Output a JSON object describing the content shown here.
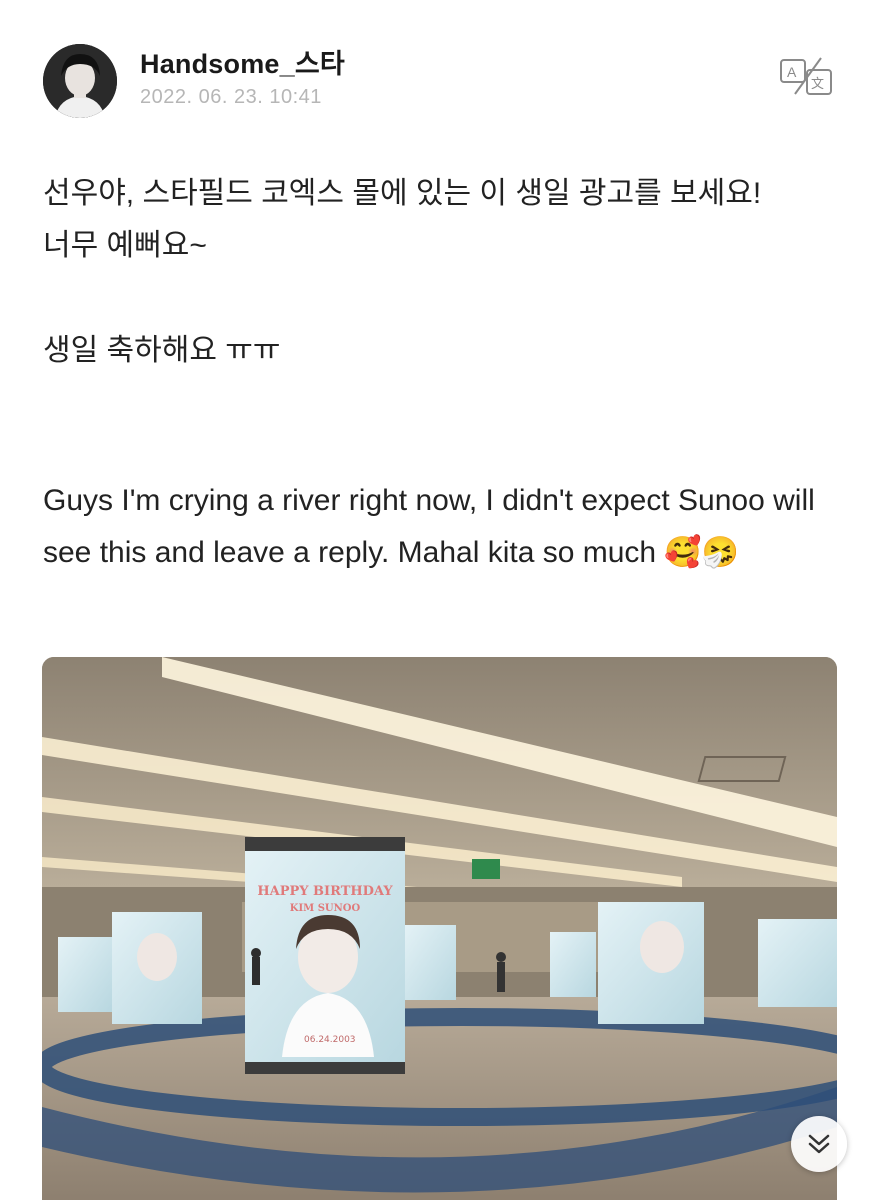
{
  "post": {
    "author": "Handsome_스타",
    "timestamp": "2022. 06. 23. 10:41",
    "paragraphs": [
      "선우야, 스타필드 코엑스 몰에 있는 이 생일 광고를 보세요!\n너무 예뻐요~",
      "생일 축하해요 ㅠㅠ",
      "Guys I'm crying a river right now, I didn't expect Sunoo will see this and leave a reply. Mahal kita so much 🥰🤧"
    ]
  },
  "photo": {
    "billboard_headline": "HAPPY BIRTHDAY",
    "billboard_name": "KIM SUNOO",
    "billboard_date": "06.24.2003"
  },
  "icons": {
    "translate": "translate-icon",
    "scroll": "chevron-double-down-icon"
  },
  "colors": {
    "text": "#222222",
    "timestamp": "#b6b6b6",
    "icon": "#8a8a8a",
    "billboard": "#cfe6ec"
  }
}
